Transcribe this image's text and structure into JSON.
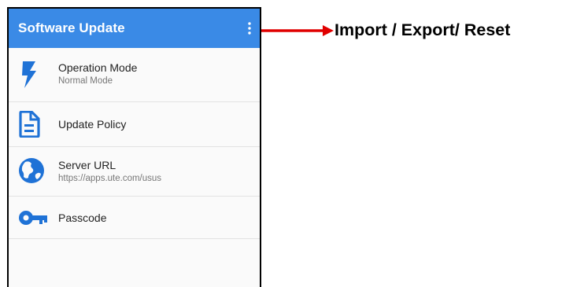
{
  "appbar": {
    "title": "Software Update",
    "menu_icon": "more-vert-icon",
    "color": "#3a8ae6"
  },
  "settings": [
    {
      "icon": "lightning-bolt-icon",
      "label": "Operation Mode",
      "value": "Normal Mode"
    },
    {
      "icon": "document-icon",
      "label": "Update Policy",
      "value": ""
    },
    {
      "icon": "globe-icon",
      "label": "Server URL",
      "value": "https://apps.ute.com/usus"
    },
    {
      "icon": "key-icon",
      "label": "Passcode",
      "value": ""
    }
  ],
  "annotation": {
    "label": "Import / Export/ Reset",
    "arrow_color": "#e00000"
  },
  "icon_color": "#1f72d6"
}
